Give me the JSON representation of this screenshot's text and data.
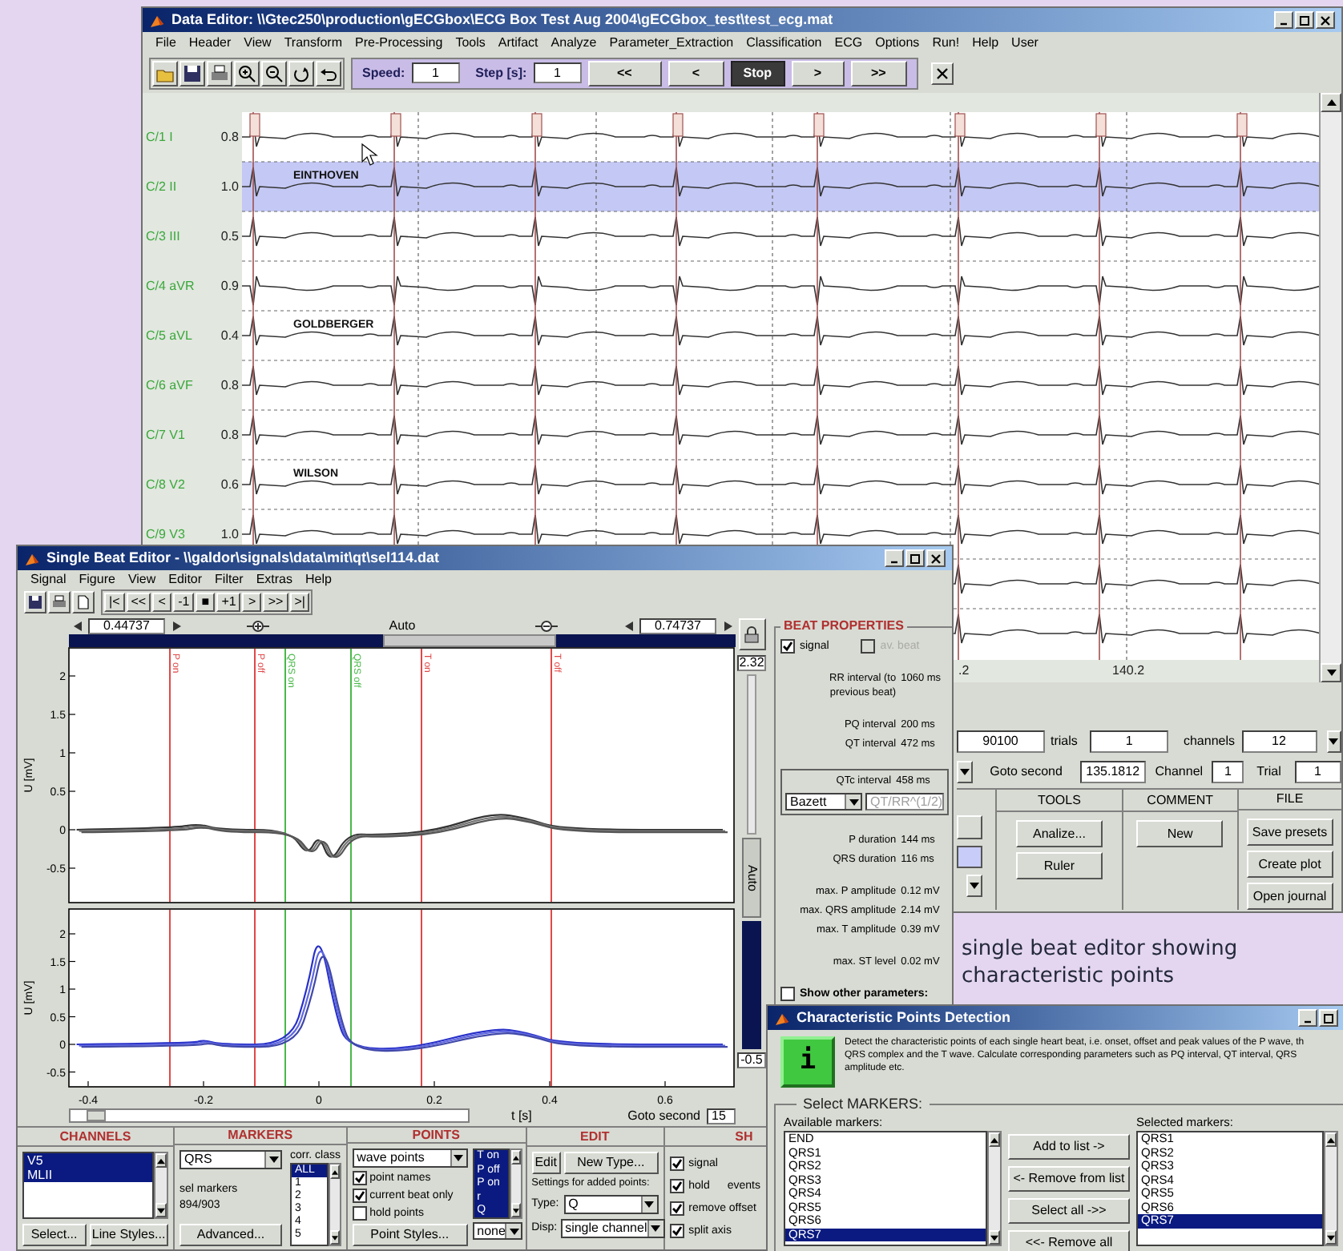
{
  "data_editor": {
    "title": "Data Editor: \\\\Gtec250\\production\\gECGbox\\ECG Box Test Aug 2004\\gECGbox_test\\test_ecg.mat",
    "menu": [
      "File",
      "Header",
      "View",
      "Transform",
      "Pre-Processing",
      "Tools",
      "Artifact",
      "Analyze",
      "Parameter_Extraction",
      "Classification",
      "ECG",
      "Options",
      "Run!",
      "Help",
      "User"
    ],
    "speed": {
      "label": "Speed:",
      "value": "1"
    },
    "step": {
      "label": "Step [s]:",
      "value": "1"
    },
    "nav_buttons": [
      {
        "label": "<<",
        "selected": false
      },
      {
        "label": "<",
        "selected": false
      },
      {
        "label": "Stop",
        "selected": true
      },
      {
        "label": ">",
        "selected": false
      },
      {
        "label": ">>",
        "selected": false
      }
    ],
    "channels": [
      {
        "label": "C/1 I",
        "scale": "0.8",
        "selected": false
      },
      {
        "label": "C/2 II",
        "scale": "1.0",
        "selected": true,
        "note": "EINTHOVEN"
      },
      {
        "label": "C/3 III",
        "scale": "0.5",
        "selected": false
      },
      {
        "label": "C/4 aVR",
        "scale": "0.9",
        "selected": false
      },
      {
        "label": "C/5 aVL",
        "scale": "0.4",
        "selected": false,
        "note": "GOLDBERGER"
      },
      {
        "label": "C/6 aVF",
        "scale": "0.8",
        "selected": false
      },
      {
        "label": "C/7 V1",
        "scale": "0.8",
        "selected": false
      },
      {
        "label": "C/8 V2",
        "scale": "0.6",
        "selected": false,
        "note": "WILSON"
      },
      {
        "label": "C/9 V3",
        "scale": "1.0",
        "selected": false
      }
    ],
    "x_ticks": [
      ".2",
      "140.2"
    ],
    "status": {
      "samples": "90100",
      "trials_label": "trials",
      "trials": "1",
      "channels_label": "channels",
      "channels": "12"
    },
    "goto": {
      "label": "Goto second",
      "value": "135.1812",
      "channel_label": "Channel",
      "channel": "1",
      "trial_label": "Trial",
      "trial": "1"
    },
    "panels": [
      {
        "title": "TOOLS",
        "buttons": [
          "Analize...",
          "Ruler"
        ]
      },
      {
        "title": "COMMENT",
        "buttons": [
          "New"
        ]
      },
      {
        "title": "FILE",
        "buttons": [
          "Save presets",
          "Create plot",
          "Open journal"
        ]
      }
    ]
  },
  "single_beat_editor": {
    "title": "Single Beat Editor - \\\\galdor\\signals\\data\\mit\\qt\\sel114.dat",
    "menu": [
      "Signal",
      "Figure",
      "View",
      "Editor",
      "Filter",
      "Extras",
      "Help"
    ],
    "nav_buttons": [
      "|<",
      "<<",
      "<",
      "-1",
      "■",
      "+1",
      ">",
      ">>",
      ">|"
    ],
    "limits": {
      "min": "0.44737",
      "zoom": "Auto",
      "max": "0.74737"
    },
    "y_scale": "2.32",
    "y_min": "-0.5",
    "vertical_zoom": "Auto",
    "markers": [
      {
        "label": "P on",
        "color": "#e04848"
      },
      {
        "label": "P off",
        "color": "#e04848"
      },
      {
        "label": "QRS on",
        "color": "#48b848"
      },
      {
        "label": "QRS off",
        "color": "#48b848"
      },
      {
        "label": "T on",
        "color": "#e04848"
      },
      {
        "label": "T off",
        "color": "#e04848"
      }
    ],
    "plots": [
      {
        "ylabel": "U [mV]",
        "y_ticks": [
          "2",
          "1.5",
          "1",
          "0.5",
          "0",
          "-0.5"
        ]
      },
      {
        "ylabel": "U [mV]",
        "y_ticks": [
          "2",
          "1.5",
          "1",
          "0.5",
          "0",
          "-0.5"
        ]
      }
    ],
    "x_ticks": [
      "-0.4",
      "-0.2",
      "0",
      "0.2",
      "0.4",
      "0.6"
    ],
    "xlabel": "t [s]",
    "goto": {
      "label": "Goto second",
      "value": "15"
    },
    "beat_properties": {
      "title": "BEAT PROPERTIES",
      "signal": {
        "label": "signal",
        "checked": true
      },
      "average": {
        "label": "av. beat",
        "checked": false,
        "disabled": true
      },
      "groups": [
        {
          "boxed": false,
          "rows": [
            {
              "label": "RR interval (to previous beat)",
              "value": "1060 ms"
            }
          ]
        },
        {
          "boxed": false,
          "rows": [
            {
              "label": "PQ interval",
              "value": "200 ms"
            },
            {
              "label": "QT interval",
              "value": "472 ms"
            }
          ]
        },
        {
          "boxed": true,
          "rows": [
            {
              "label": "QTc interval",
              "value": "458 ms"
            }
          ],
          "method": "Bazett",
          "formula": "QT/RR^(1/2)"
        },
        {
          "boxed": false,
          "rows": [
            {
              "label": "P duration",
              "value": "144 ms"
            },
            {
              "label": "QRS duration",
              "value": "116 ms"
            }
          ]
        },
        {
          "boxed": false,
          "rows": [
            {
              "label": "max. P amplitude",
              "value": "0.12 mV"
            },
            {
              "label": "max. QRS amplitude",
              "value": "2.14 mV"
            },
            {
              "label": "max. T amplitude",
              "value": "0.39 mV"
            }
          ]
        },
        {
          "boxed": false,
          "rows": [
            {
              "label": "max. ST level",
              "value": "0.02 mV"
            }
          ]
        }
      ],
      "show_other": {
        "label": "Show other parameters:",
        "checked": false
      }
    },
    "channels_panel": {
      "title": "CHANNELS",
      "items": [
        {
          "label": "V5",
          "selected": true
        },
        {
          "label": "MLII",
          "selected": true
        }
      ],
      "buttons": [
        "Select...",
        "Line Styles..."
      ]
    },
    "markers_panel": {
      "title": "MARKERS",
      "marker": "QRS",
      "sel_label": "sel markers",
      "sel_count": "894/903",
      "class_label": "corr. class",
      "classes": [
        {
          "label": "ALL",
          "selected": true
        },
        {
          "label": "1",
          "selected": false
        },
        {
          "label": "2",
          "selected": false
        },
        {
          "label": "3",
          "selected": false
        },
        {
          "label": "4",
          "selected": false
        },
        {
          "label": "5",
          "selected": false
        }
      ],
      "button": "Advanced..."
    },
    "points_panel": {
      "title": "POINTS",
      "mode": "wave points",
      "options": [
        {
          "label": "point names",
          "checked": true
        },
        {
          "label": "current beat only",
          "checked": true
        },
        {
          "label": "hold points",
          "checked": false
        }
      ],
      "button": "Point Styles...",
      "types": [
        {
          "label": "T on",
          "selected": true
        },
        {
          "label": "P off",
          "selected": true
        },
        {
          "label": "P on",
          "selected": true
        },
        {
          "label": "r",
          "selected": true
        },
        {
          "label": "Q",
          "selected": true
        }
      ],
      "none": "none"
    },
    "edit_panel": {
      "title": "EDIT",
      "edit_button": "Edit",
      "new_type_button": "New Type...",
      "settings_label": "Settings for added points:",
      "type_label": "Type:",
      "type": "Q",
      "disp_label": "Disp:",
      "disp": "single channel"
    },
    "show_panel": {
      "title": "SH",
      "options": [
        {
          "label": "signal",
          "checked": true
        },
        {
          "label": "hold",
          "checked": true,
          "extra": "events"
        },
        {
          "label": "remove offset",
          "checked": true
        },
        {
          "label": "split axis",
          "checked": true
        }
      ]
    }
  },
  "caption": "single beat editor showing characteristic points",
  "detection": {
    "title": "Characteristic Points Detection",
    "icon_letter": "i",
    "description": [
      "Detect the characteristic points of each single heart beat, i.e. onset, offset and peak values of the P wave, th",
      "QRS complex and the T wave. Calculate corresponding parameters such as PQ interval, QT interval, QRS",
      "amplitude etc."
    ],
    "group_title": "Select MARKERS:",
    "available_label": "Available markers:",
    "available": [
      {
        "label": "END",
        "selected": false
      },
      {
        "label": "QRS1",
        "selected": false
      },
      {
        "label": "QRS2",
        "selected": false
      },
      {
        "label": "QRS3",
        "selected": false
      },
      {
        "label": "QRS4",
        "selected": false
      },
      {
        "label": "QRS5",
        "selected": false
      },
      {
        "label": "QRS6",
        "selected": false
      },
      {
        "label": "QRS7",
        "selected": true
      }
    ],
    "buttons": [
      "Add to list ->",
      "<- Remove from list",
      "Select all ->>",
      "<<- Remove all"
    ],
    "selected_label": "Selected markers:",
    "selected_markers": [
      {
        "label": "QRS1",
        "selected": false
      },
      {
        "label": "QRS2",
        "selected": false
      },
      {
        "label": "QRS3",
        "selected": false
      },
      {
        "label": "QRS4",
        "selected": false
      },
      {
        "label": "QRS5",
        "selected": false
      },
      {
        "label": "QRS6",
        "selected": false
      },
      {
        "label": "QRS7",
        "selected": true
      }
    ]
  }
}
